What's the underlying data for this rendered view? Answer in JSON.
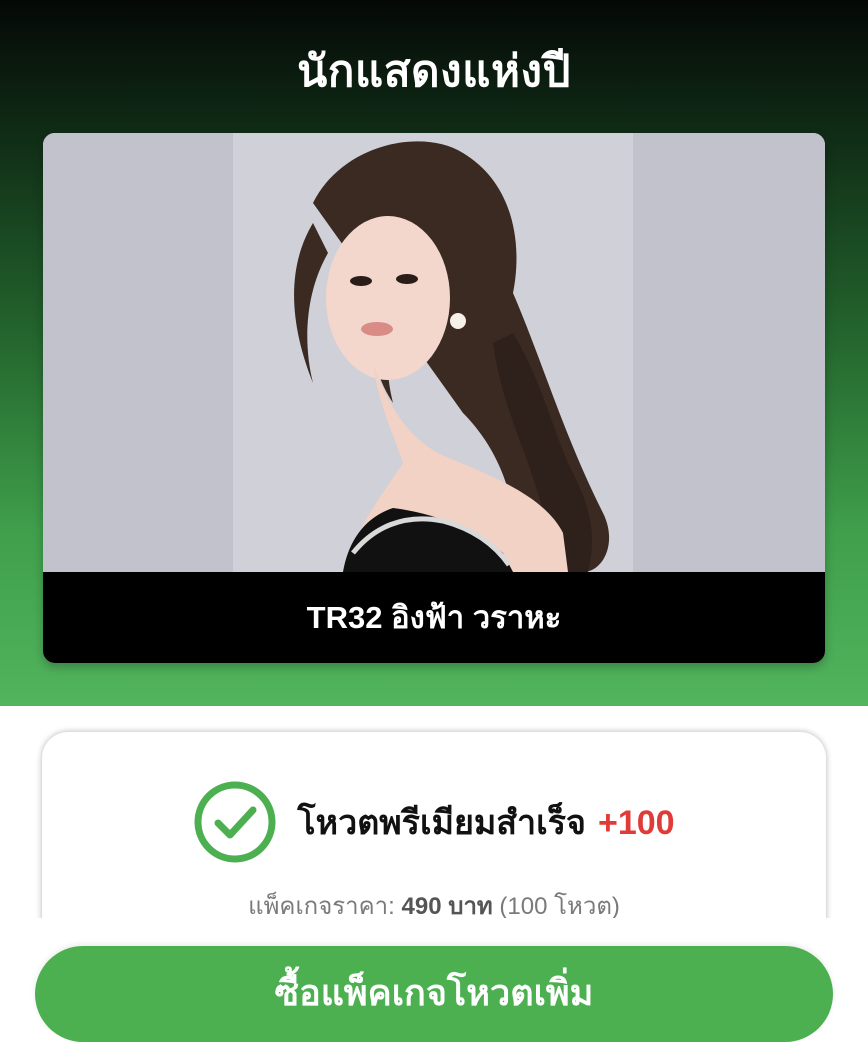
{
  "header": {
    "title": "นักแสดงแห่งปี"
  },
  "candidate": {
    "name": "TR32 อิงฟ้า วราหะ",
    "photo_icon": "portrait-photo"
  },
  "result": {
    "icon": "check-circle-icon",
    "success_text": "โหวตพรีเมียมสำเร็จ",
    "votes_added": "+100",
    "package_label": "แพ็คเกจราคา:",
    "package_price": "490 บาท",
    "package_votes": "(100 โหวต)"
  },
  "actions": {
    "buy_label": "ซื้อแพ็คเกจโหวตเพิ่ม"
  },
  "colors": {
    "accent_green": "#4caf50",
    "plus_red": "#e03b36"
  }
}
